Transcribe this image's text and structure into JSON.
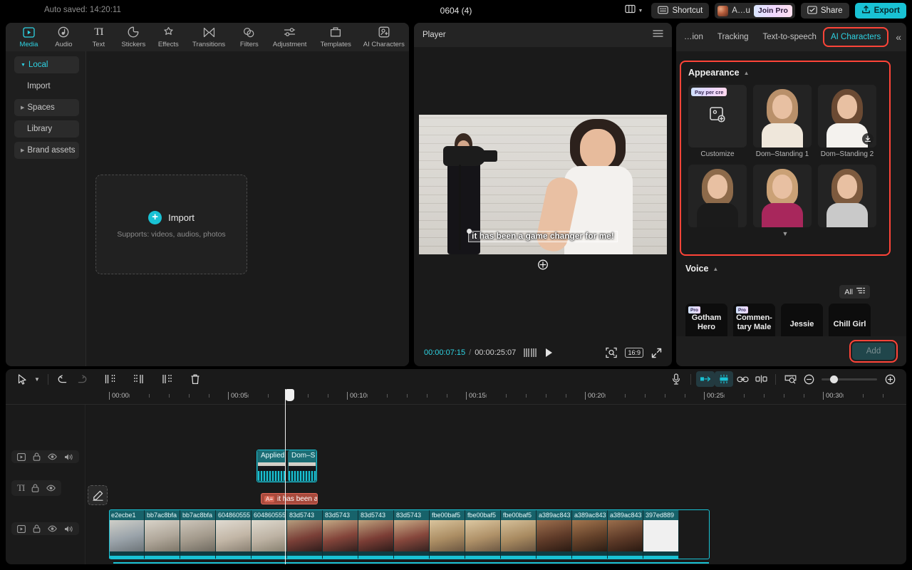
{
  "titlebar": {
    "autosave": "Auto saved: 14:20:11",
    "project_title": "0604 (4)",
    "shortcut_label": "Shortcut",
    "user_label": "A…u",
    "join_pro_label": "Join Pro",
    "share_label": "Share",
    "export_label": "Export"
  },
  "toolbar_tabs": [
    {
      "label": "Media",
      "icon": "media-icon",
      "active": true
    },
    {
      "label": "Audio",
      "icon": "audio-icon",
      "active": false
    },
    {
      "label": "Text",
      "icon": "text-icon",
      "active": false
    },
    {
      "label": "Stickers",
      "icon": "stickers-icon",
      "active": false
    },
    {
      "label": "Effects",
      "icon": "effects-icon",
      "active": false
    },
    {
      "label": "Transitions",
      "icon": "transitions-icon",
      "active": false
    },
    {
      "label": "Filters",
      "icon": "filters-icon",
      "active": false
    },
    {
      "label": "Adjustment",
      "icon": "adjustment-icon",
      "active": false
    },
    {
      "label": "Templates",
      "icon": "templates-icon",
      "active": false
    },
    {
      "label": "AI Characters",
      "icon": "ai-characters-icon",
      "active": false
    }
  ],
  "sidenav": [
    {
      "label": "Local",
      "expandable": true,
      "active": true
    },
    {
      "label": "Import",
      "expandable": false,
      "active": false
    },
    {
      "label": "Spaces",
      "expandable": true,
      "active": false
    },
    {
      "label": "Library",
      "expandable": false,
      "active": false
    },
    {
      "label": "Brand assets",
      "expandable": true,
      "active": false
    }
  ],
  "dropzone": {
    "label": "Import",
    "sub": "Supports: videos, audios, photos"
  },
  "player": {
    "title": "Player",
    "subtitle_text": "it has been a game changer for me!",
    "current_time": "00:00:07:15",
    "separator": "/",
    "duration": "00:00:25:07",
    "ratio_label": "16:9"
  },
  "right_tabs": [
    {
      "label": "…ion",
      "active": false
    },
    {
      "label": "Tracking",
      "active": false
    },
    {
      "label": "Text-to-speech",
      "active": false
    },
    {
      "label": "AI Characters",
      "active": true,
      "highlight": true
    }
  ],
  "appearance": {
    "title": "Appearance",
    "pay_tag": "Pay per cre",
    "items": [
      {
        "name": "Customize",
        "kind": "customize"
      },
      {
        "name": "Dom–Standing 1",
        "kind": "avatar",
        "hair": "#b9906a",
        "body": "#efe7db"
      },
      {
        "name": "Dom–Standing 2",
        "kind": "avatar",
        "hair": "#6b4a33",
        "body": "#f4f2ee",
        "download": true
      },
      {
        "name": "",
        "kind": "avatar",
        "hair": "#8d6a4a",
        "body": "#1b1b1b"
      },
      {
        "name": "",
        "kind": "avatar",
        "hair": "#caa176",
        "body": "#a8275c"
      },
      {
        "name": "",
        "kind": "avatar",
        "hair": "#7d5a3e",
        "body": "#c9c9c9"
      }
    ]
  },
  "voice": {
    "title": "Voice",
    "filter_label": "All",
    "items": [
      {
        "label": "Gotham Hero",
        "pro": true,
        "pro_label": "Pro"
      },
      {
        "label": "Commen-tary Male",
        "pro": true,
        "pro_label": "Pro"
      },
      {
        "label": "Jessie",
        "pro": false
      },
      {
        "label": "Chill Girl",
        "pro": false
      }
    ],
    "add_label": "Add"
  },
  "timeline": {
    "ruler_labels": [
      "00:00",
      "00:05",
      "00:10",
      "00:15",
      "00:20",
      "00:25",
      "00:30"
    ],
    "video_track_clips": [
      {
        "label": "Applied"
      },
      {
        "label": "Dom–S"
      }
    ],
    "text_track_clip": {
      "badge": "A≡",
      "label": "it has been a"
    },
    "main_track_clips": [
      "e2ecbe1",
      "bb7ac8bfa",
      "bb7ac8bfa",
      "604860555",
      "604860555",
      "83d5743",
      "83d5743",
      "83d5743",
      "83d5743",
      "fbe00baf5",
      "fbe00baf5",
      "fbe00baf5",
      "a389ac843",
      "a389ac843",
      "a389ac843",
      "397ed889"
    ]
  }
}
